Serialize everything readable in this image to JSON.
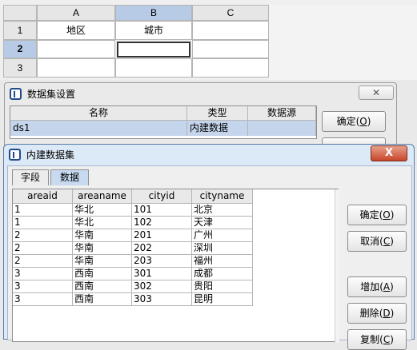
{
  "spreadsheet": {
    "columns": [
      "A",
      "B",
      "C"
    ],
    "rows": [
      "1",
      "2",
      "3"
    ],
    "cells": {
      "A1": "地区",
      "B1": "城市"
    }
  },
  "dataset_settings": {
    "title": "数据集设置",
    "columns": [
      "名称",
      "类型",
      "数据源"
    ],
    "row": {
      "name": "ds1",
      "type": "内建数据",
      "source": ""
    },
    "ok_label": "确定",
    "ok_key": "O"
  },
  "builtin_dataset": {
    "title": "内建数据集",
    "close_label": "X",
    "tabs": [
      "字段",
      "数据"
    ],
    "columns": [
      "areaid",
      "areaname",
      "cityid",
      "cityname"
    ],
    "rows": [
      [
        "1",
        "华北",
        "101",
        "北京"
      ],
      [
        "1",
        "华北",
        "102",
        "天津"
      ],
      [
        "2",
        "华南",
        "201",
        "广州"
      ],
      [
        "2",
        "华南",
        "202",
        "深圳"
      ],
      [
        "2",
        "华南",
        "203",
        "福州"
      ],
      [
        "3",
        "西南",
        "301",
        "成都"
      ],
      [
        "3",
        "西南",
        "302",
        "贵阳"
      ],
      [
        "3",
        "西南",
        "303",
        "昆明"
      ]
    ],
    "buttons": {
      "ok": {
        "label": "确定",
        "key": "O"
      },
      "cancel": {
        "label": "取消",
        "key": "C"
      },
      "add": {
        "label": "增加",
        "key": "A"
      },
      "delete": {
        "label": "删除",
        "key": "D"
      },
      "copy": {
        "label": "复制",
        "key": "C"
      }
    }
  }
}
